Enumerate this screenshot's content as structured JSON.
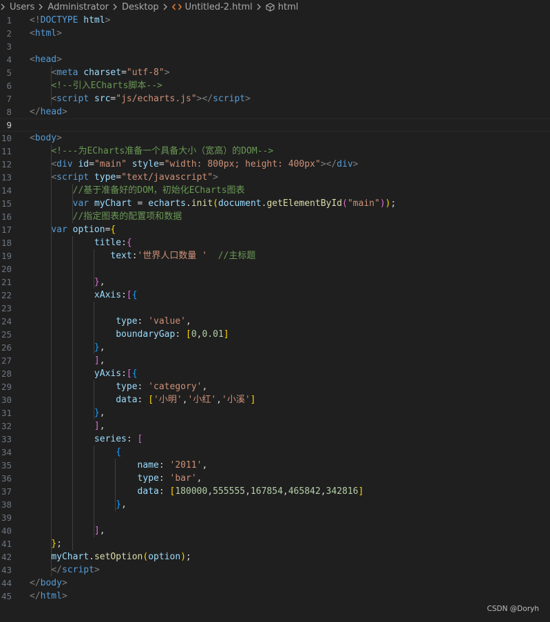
{
  "breadcrumb": {
    "items": [
      "Users",
      "Administrator",
      "Desktop",
      "Untitled-2.html",
      "html"
    ],
    "icons": [
      "chevron-right-icon",
      "html-file-icon",
      "cube-icon"
    ]
  },
  "editor": {
    "current_line": 9,
    "lines": [
      {
        "n": "1",
        "tokens": [
          [
            "t-punct",
            "<!"
          ],
          [
            "t-tag",
            "DOCTYPE"
          ],
          [
            "t-plain",
            " "
          ],
          [
            "t-attr",
            "html"
          ],
          [
            "t-punct",
            ">"
          ]
        ]
      },
      {
        "n": "2",
        "tokens": [
          [
            "t-punct",
            "<"
          ],
          [
            "t-tag",
            "html"
          ],
          [
            "t-punct",
            ">"
          ]
        ]
      },
      {
        "n": "3",
        "tokens": []
      },
      {
        "n": "4",
        "tokens": [
          [
            "t-punct",
            "<"
          ],
          [
            "t-tag",
            "head"
          ],
          [
            "t-punct",
            ">"
          ]
        ]
      },
      {
        "n": "5",
        "tokens": [
          [
            "t-plain",
            "    "
          ],
          [
            "t-punct",
            "<"
          ],
          [
            "t-tag",
            "meta"
          ],
          [
            "t-plain",
            " "
          ],
          [
            "t-attr",
            "charset"
          ],
          [
            "t-plain",
            "="
          ],
          [
            "t-str",
            "\"utf-8\""
          ],
          [
            "t-punct",
            ">"
          ]
        ]
      },
      {
        "n": "6",
        "tokens": [
          [
            "t-plain",
            "    "
          ],
          [
            "t-comment",
            "<!--引入ECharts脚本-->"
          ]
        ]
      },
      {
        "n": "7",
        "tokens": [
          [
            "t-plain",
            "    "
          ],
          [
            "t-punct",
            "<"
          ],
          [
            "t-tag",
            "script"
          ],
          [
            "t-plain",
            " "
          ],
          [
            "t-attr",
            "src"
          ],
          [
            "t-plain",
            "="
          ],
          [
            "t-str",
            "\"js/echarts.js\""
          ],
          [
            "t-punct",
            "></"
          ],
          [
            "t-tag",
            "script"
          ],
          [
            "t-punct",
            ">"
          ]
        ]
      },
      {
        "n": "8",
        "tokens": [
          [
            "t-punct",
            "</"
          ],
          [
            "t-tag",
            "head"
          ],
          [
            "t-punct",
            ">"
          ]
        ]
      },
      {
        "n": "9",
        "tokens": []
      },
      {
        "n": "10",
        "tokens": [
          [
            "t-punct",
            "<"
          ],
          [
            "t-tag",
            "body"
          ],
          [
            "t-punct",
            ">"
          ]
        ]
      },
      {
        "n": "11",
        "tokens": [
          [
            "t-plain",
            "    "
          ],
          [
            "t-comment",
            "<!---为ECharts准备一个具备大小（宽高）的DOM-->"
          ]
        ]
      },
      {
        "n": "12",
        "tokens": [
          [
            "t-plain",
            "    "
          ],
          [
            "t-punct",
            "<"
          ],
          [
            "t-tag",
            "div"
          ],
          [
            "t-plain",
            " "
          ],
          [
            "t-attr",
            "id"
          ],
          [
            "t-plain",
            "="
          ],
          [
            "t-str",
            "\"main\""
          ],
          [
            "t-plain",
            " "
          ],
          [
            "t-attr",
            "style"
          ],
          [
            "t-plain",
            "="
          ],
          [
            "t-str",
            "\"width: 800px; height: 400px\""
          ],
          [
            "t-punct",
            "></"
          ],
          [
            "t-tag",
            "div"
          ],
          [
            "t-punct",
            ">"
          ]
        ]
      },
      {
        "n": "13",
        "tokens": [
          [
            "t-plain",
            "    "
          ],
          [
            "t-punct",
            "<"
          ],
          [
            "t-tag",
            "script"
          ],
          [
            "t-plain",
            " "
          ],
          [
            "t-attr",
            "type"
          ],
          [
            "t-plain",
            "="
          ],
          [
            "t-str",
            "\"text/javascript\""
          ],
          [
            "t-punct",
            ">"
          ]
        ]
      },
      {
        "n": "14",
        "tokens": [
          [
            "t-plain",
            "        "
          ],
          [
            "t-comment",
            "//基于准备好的DOM，初始化ECharts图表"
          ]
        ]
      },
      {
        "n": "15",
        "tokens": [
          [
            "t-plain",
            "        "
          ],
          [
            "t-kw",
            "var"
          ],
          [
            "t-plain",
            " "
          ],
          [
            "t-var",
            "myChart"
          ],
          [
            "t-plain",
            " = "
          ],
          [
            "t-var",
            "echarts"
          ],
          [
            "t-plain",
            "."
          ],
          [
            "t-fn",
            "init"
          ],
          [
            "t-b1",
            "("
          ],
          [
            "t-var",
            "document"
          ],
          [
            "t-plain",
            "."
          ],
          [
            "t-fn",
            "getElementById"
          ],
          [
            "t-b2",
            "("
          ],
          [
            "t-str",
            "\"main\""
          ],
          [
            "t-b2",
            ")"
          ],
          [
            "t-b1",
            ")"
          ],
          [
            "t-plain",
            ";"
          ]
        ]
      },
      {
        "n": "16",
        "tokens": [
          [
            "t-plain",
            "        "
          ],
          [
            "t-comment",
            "//指定图表的配置项和数据"
          ]
        ]
      },
      {
        "n": "17",
        "tokens": [
          [
            "t-plain",
            "    "
          ],
          [
            "t-kw",
            "var"
          ],
          [
            "t-plain",
            " "
          ],
          [
            "t-var",
            "option"
          ],
          [
            "t-plain",
            "="
          ],
          [
            "t-b1",
            "{"
          ]
        ]
      },
      {
        "n": "18",
        "tokens": [
          [
            "t-plain",
            "            "
          ],
          [
            "t-var",
            "title"
          ],
          [
            "t-plain",
            ":"
          ],
          [
            "t-b2",
            "{"
          ]
        ]
      },
      {
        "n": "19",
        "tokens": [
          [
            "t-plain",
            "               "
          ],
          [
            "t-var",
            "text"
          ],
          [
            "t-plain",
            ":"
          ],
          [
            "t-str",
            "'世界人口数量 '"
          ],
          [
            "t-plain",
            "  "
          ],
          [
            "t-comment",
            "//主标题"
          ]
        ]
      },
      {
        "n": "20",
        "tokens": []
      },
      {
        "n": "21",
        "tokens": [
          [
            "t-plain",
            "            "
          ],
          [
            "t-b2",
            "}"
          ],
          [
            "t-plain",
            ","
          ]
        ]
      },
      {
        "n": "22",
        "tokens": [
          [
            "t-plain",
            "            "
          ],
          [
            "t-var",
            "xAxis"
          ],
          [
            "t-plain",
            ":"
          ],
          [
            "t-b2",
            "["
          ],
          [
            "t-b3",
            "{"
          ]
        ]
      },
      {
        "n": "23",
        "tokens": []
      },
      {
        "n": "24",
        "tokens": [
          [
            "t-plain",
            "                "
          ],
          [
            "t-var",
            "type"
          ],
          [
            "t-plain",
            ": "
          ],
          [
            "t-str",
            "'value'"
          ],
          [
            "t-plain",
            ","
          ]
        ]
      },
      {
        "n": "25",
        "tokens": [
          [
            "t-plain",
            "                "
          ],
          [
            "t-var",
            "boundaryGap"
          ],
          [
            "t-plain",
            ": "
          ],
          [
            "t-b1",
            "["
          ],
          [
            "t-num",
            "0"
          ],
          [
            "t-plain",
            ","
          ],
          [
            "t-num",
            "0.01"
          ],
          [
            "t-b1",
            "]"
          ]
        ]
      },
      {
        "n": "26",
        "tokens": [
          [
            "t-plain",
            "            "
          ],
          [
            "t-b3",
            "}"
          ],
          [
            "t-plain",
            ","
          ]
        ]
      },
      {
        "n": "27",
        "tokens": [
          [
            "t-plain",
            "            "
          ],
          [
            "t-b2",
            "]"
          ],
          [
            "t-plain",
            ","
          ]
        ]
      },
      {
        "n": "28",
        "tokens": [
          [
            "t-plain",
            "            "
          ],
          [
            "t-var",
            "yAxis"
          ],
          [
            "t-plain",
            ":"
          ],
          [
            "t-b2",
            "["
          ],
          [
            "t-b3",
            "{"
          ]
        ]
      },
      {
        "n": "29",
        "tokens": [
          [
            "t-plain",
            "                "
          ],
          [
            "t-var",
            "type"
          ],
          [
            "t-plain",
            ": "
          ],
          [
            "t-str",
            "'category'"
          ],
          [
            "t-plain",
            ","
          ]
        ]
      },
      {
        "n": "30",
        "tokens": [
          [
            "t-plain",
            "                "
          ],
          [
            "t-var",
            "data"
          ],
          [
            "t-plain",
            ": "
          ],
          [
            "t-b1",
            "["
          ],
          [
            "t-str",
            "'小明'"
          ],
          [
            "t-plain",
            ","
          ],
          [
            "t-str",
            "'小红'"
          ],
          [
            "t-plain",
            ","
          ],
          [
            "t-str",
            "'小溪'"
          ],
          [
            "t-b1",
            "]"
          ]
        ]
      },
      {
        "n": "31",
        "tokens": [
          [
            "t-plain",
            "            "
          ],
          [
            "t-b3",
            "}"
          ],
          [
            "t-plain",
            ","
          ]
        ]
      },
      {
        "n": "32",
        "tokens": [
          [
            "t-plain",
            "            "
          ],
          [
            "t-b2",
            "]"
          ],
          [
            "t-plain",
            ","
          ]
        ]
      },
      {
        "n": "33",
        "tokens": [
          [
            "t-plain",
            "            "
          ],
          [
            "t-var",
            "series"
          ],
          [
            "t-plain",
            ": "
          ],
          [
            "t-b2",
            "["
          ]
        ]
      },
      {
        "n": "34",
        "tokens": [
          [
            "t-plain",
            "                "
          ],
          [
            "t-b3",
            "{"
          ]
        ]
      },
      {
        "n": "35",
        "tokens": [
          [
            "t-plain",
            "                    "
          ],
          [
            "t-var",
            "name"
          ],
          [
            "t-plain",
            ": "
          ],
          [
            "t-str",
            "'2011'"
          ],
          [
            "t-plain",
            ","
          ]
        ]
      },
      {
        "n": "36",
        "tokens": [
          [
            "t-plain",
            "                    "
          ],
          [
            "t-var",
            "type"
          ],
          [
            "t-plain",
            ": "
          ],
          [
            "t-str",
            "'bar'"
          ],
          [
            "t-plain",
            ","
          ]
        ]
      },
      {
        "n": "37",
        "tokens": [
          [
            "t-plain",
            "                    "
          ],
          [
            "t-var",
            "data"
          ],
          [
            "t-plain",
            ": "
          ],
          [
            "t-b1",
            "["
          ],
          [
            "t-num",
            "180000"
          ],
          [
            "t-plain",
            ","
          ],
          [
            "t-num",
            "555555"
          ],
          [
            "t-plain",
            ","
          ],
          [
            "t-num",
            "167854"
          ],
          [
            "t-plain",
            ","
          ],
          [
            "t-num",
            "465842"
          ],
          [
            "t-plain",
            ","
          ],
          [
            "t-num",
            "342816"
          ],
          [
            "t-b1",
            "]"
          ]
        ]
      },
      {
        "n": "38",
        "tokens": [
          [
            "t-plain",
            "                "
          ],
          [
            "t-b3",
            "}"
          ],
          [
            "t-plain",
            ","
          ]
        ]
      },
      {
        "n": "39",
        "tokens": []
      },
      {
        "n": "40",
        "tokens": [
          [
            "t-plain",
            "            "
          ],
          [
            "t-b2",
            "]"
          ],
          [
            "t-plain",
            ","
          ]
        ]
      },
      {
        "n": "41",
        "tokens": [
          [
            "t-plain",
            "    "
          ],
          [
            "t-b1",
            "}"
          ],
          [
            "t-plain",
            ";"
          ]
        ]
      },
      {
        "n": "42",
        "tokens": [
          [
            "t-plain",
            "    "
          ],
          [
            "t-var",
            "myChart"
          ],
          [
            "t-plain",
            "."
          ],
          [
            "t-fn",
            "setOption"
          ],
          [
            "t-b1",
            "("
          ],
          [
            "t-var",
            "option"
          ],
          [
            "t-b1",
            ")"
          ],
          [
            "t-plain",
            ";"
          ]
        ]
      },
      {
        "n": "43",
        "tokens": [
          [
            "t-plain",
            "    "
          ],
          [
            "t-punct",
            "</"
          ],
          [
            "t-tag",
            "script"
          ],
          [
            "t-punct",
            ">"
          ]
        ]
      },
      {
        "n": "44",
        "tokens": [
          [
            "t-punct",
            "</"
          ],
          [
            "t-tag",
            "body"
          ],
          [
            "t-punct",
            ">"
          ]
        ]
      },
      {
        "n": "45",
        "tokens": [
          [
            "t-punct",
            "</"
          ],
          [
            "t-tag",
            "html"
          ],
          [
            "t-punct",
            ">"
          ]
        ]
      }
    ]
  },
  "watermark": "CSDN @Doryh"
}
